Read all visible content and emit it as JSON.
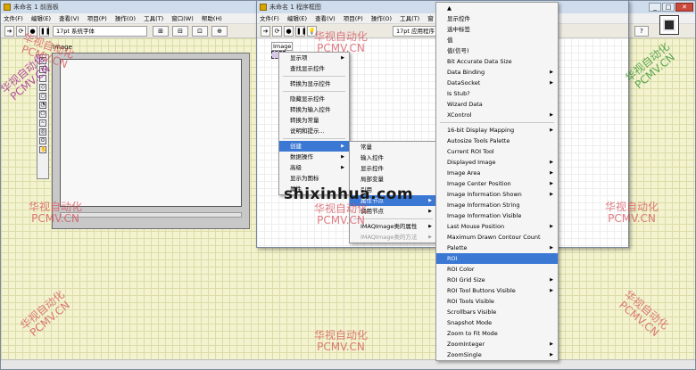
{
  "front_panel": {
    "title": "未命名 1 前面板",
    "menus": [
      "文件(F)",
      "编辑(E)",
      "查看(V)",
      "项目(P)",
      "操作(O)",
      "工具(T)",
      "窗口(W)",
      "帮助(H)"
    ],
    "font": "17pt 系统字体",
    "control_label": "Image"
  },
  "block_diagram": {
    "title": "未命名 1 程序框图",
    "menus": [
      "文件(F)",
      "编辑(E)",
      "查看(V)",
      "项目(P)",
      "操作(O)",
      "工具(T)",
      "窗"
    ],
    "font": "17pt 应用程序",
    "terminal_label": "Image"
  },
  "context_menu": {
    "items": [
      {
        "label": "显示项",
        "sub": true
      },
      {
        "label": "查找显示控件",
        "sub": false
      },
      {
        "sep": true
      },
      {
        "label": "转换为显示控件",
        "sub": false
      },
      {
        "sep": true
      },
      {
        "label": "隐藏显示控件",
        "sub": false
      },
      {
        "label": "转换为输入控件",
        "sub": false
      },
      {
        "label": "转换为常量",
        "sub": false
      },
      {
        "label": "说明和提示...",
        "sub": false
      },
      {
        "sep": true
      },
      {
        "label": "创建",
        "sub": true,
        "hl": true
      },
      {
        "label": "数据操作",
        "sub": true
      },
      {
        "label": "高级",
        "sub": true
      },
      {
        "label": "显示为图标",
        "sub": false
      },
      {
        "label": "属性",
        "sub": false
      }
    ]
  },
  "create_menu": {
    "items": [
      {
        "label": "常量",
        "sub": false
      },
      {
        "label": "输入控件",
        "sub": false
      },
      {
        "label": "显示控件",
        "sub": false
      },
      {
        "label": "局部变量",
        "sub": false
      },
      {
        "label": "引用",
        "sub": false
      },
      {
        "label": "属性节点",
        "sub": true,
        "hl": true
      },
      {
        "label": "调用节点",
        "sub": true
      },
      {
        "sep": true
      },
      {
        "label": "IMAQImage类的属性",
        "sub": true
      },
      {
        "label": "IMAQImage类的方法",
        "sub": true,
        "dis": true
      }
    ]
  },
  "property_menu": {
    "items": [
      {
        "label": "▲",
        "sub": false
      },
      {
        "label": "显示控件",
        "sub": false
      },
      {
        "label": "选中标签",
        "sub": false
      },
      {
        "label": "值",
        "sub": false
      },
      {
        "label": "值(信号)",
        "sub": false
      },
      {
        "label": "Bit Accurate Data Size",
        "sub": false
      },
      {
        "label": "Data Binding",
        "sub": true
      },
      {
        "label": "DataSocket",
        "sub": true
      },
      {
        "label": "Is Stub?",
        "sub": false
      },
      {
        "label": "Wizard Data",
        "sub": false
      },
      {
        "label": "XControl",
        "sub": true
      },
      {
        "sep": true
      },
      {
        "label": "16-bit Display Mapping",
        "sub": true
      },
      {
        "label": "Autosize Tools Palette",
        "sub": false
      },
      {
        "label": "Current ROI Tool",
        "sub": false
      },
      {
        "label": "Displayed Image",
        "sub": true
      },
      {
        "label": "Image Area",
        "sub": true
      },
      {
        "label": "Image Center Position",
        "sub": true
      },
      {
        "label": "Image Information Shown",
        "sub": true
      },
      {
        "label": "Image Information String",
        "sub": false
      },
      {
        "label": "Image Information Visible",
        "sub": false
      },
      {
        "label": "Last Mouse Position",
        "sub": true
      },
      {
        "label": "Maximum Drawn Contour Count",
        "sub": false
      },
      {
        "label": "Palette",
        "sub": true
      },
      {
        "label": "ROI",
        "sub": false,
        "hl": true
      },
      {
        "label": "ROI Color",
        "sub": false
      },
      {
        "label": "ROI Grid Size",
        "sub": true
      },
      {
        "label": "ROI Tool Buttons Visible",
        "sub": true
      },
      {
        "label": "ROI Tools Visible",
        "sub": false
      },
      {
        "label": "Scrollbars Visible",
        "sub": false
      },
      {
        "label": "Snapshot Mode",
        "sub": false
      },
      {
        "label": "Zoom to Fit Mode",
        "sub": false
      },
      {
        "label": "ZoomInteger",
        "sub": true
      },
      {
        "label": "ZoomSingle",
        "sub": true
      }
    ]
  },
  "watermarks": {
    "cn": "华视自动化",
    "en": "PCMV.CN",
    "center": "shixinhua.com"
  },
  "colors": {
    "highlight": "#3a78d4",
    "panel": "#f3f3cf",
    "watermark": "#d4505a"
  }
}
